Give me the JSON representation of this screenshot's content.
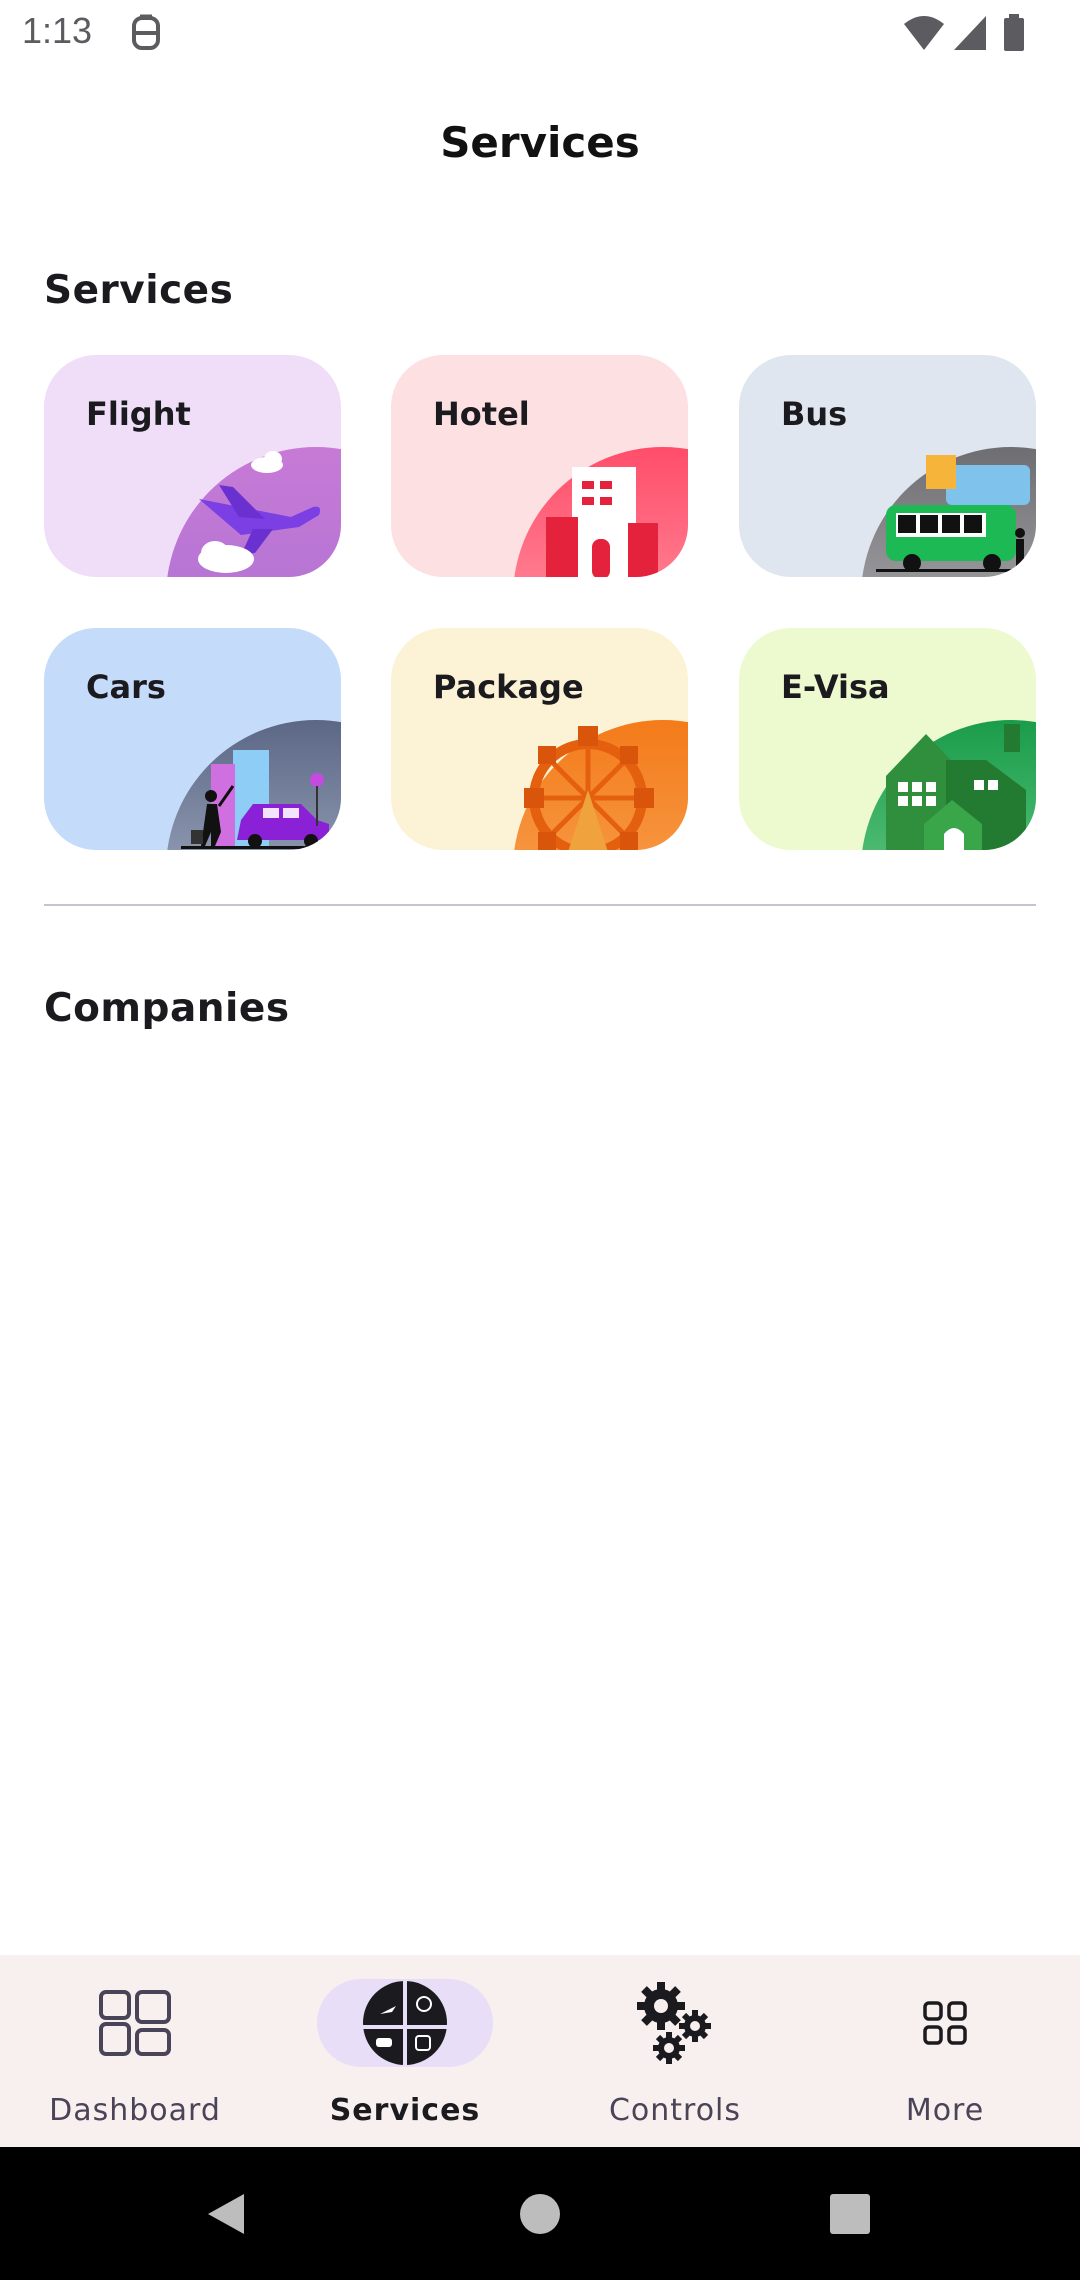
{
  "status_bar": {
    "time": "1:13",
    "icons": [
      "app-notification-icon",
      "wifi-icon",
      "signal-icon",
      "battery-icon"
    ]
  },
  "header": {
    "title": "Services"
  },
  "sections": {
    "services_title": "Services",
    "companies_title": "Companies"
  },
  "services": [
    {
      "label": "Flight",
      "icon": "airplane-icon",
      "background": "#f0def8"
    },
    {
      "label": "Hotel",
      "icon": "hotel-building-icon",
      "background": "#fde0e2"
    },
    {
      "label": "Bus",
      "icon": "bus-icon",
      "background": "#dfe6f0"
    },
    {
      "label": "Cars",
      "icon": "taxi-car-icon",
      "background": "#c5dbfa"
    },
    {
      "label": "Package",
      "icon": "ferris-wheel-icon",
      "background": "#fcf3d6"
    },
    {
      "label": "E-Visa",
      "icon": "house-icon",
      "background": "#edfacf"
    }
  ],
  "bottom_nav": {
    "active": "Services",
    "items": [
      {
        "label": "Dashboard",
        "icon": "dashboard-grid-icon"
      },
      {
        "label": "Services",
        "icon": "services-pie-icon"
      },
      {
        "label": "Controls",
        "icon": "gears-icon"
      },
      {
        "label": "More",
        "icon": "apps-grid-icon"
      }
    ]
  },
  "colors": {
    "accent_pill": "#e8def8",
    "nav_background": "#f8f0ef",
    "text_primary": "#1b1b1f"
  }
}
